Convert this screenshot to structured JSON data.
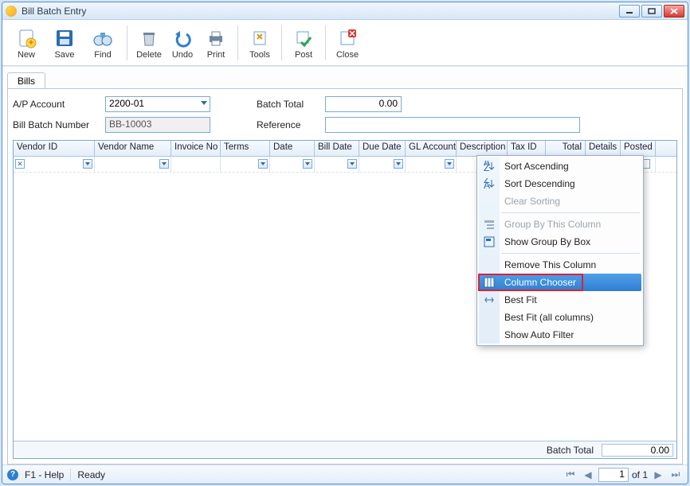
{
  "window": {
    "title": "Bill Batch Entry"
  },
  "toolbar": {
    "new": "New",
    "save": "Save",
    "find": "Find",
    "delete": "Delete",
    "undo": "Undo",
    "print": "Print",
    "tools": "Tools",
    "post": "Post",
    "close": "Close"
  },
  "tabs": {
    "bills": "Bills"
  },
  "form": {
    "ap_label": "A/P Account",
    "ap_value": "2200-01",
    "bbn_label": "Bill Batch Number",
    "bbn_value": "BB-10003",
    "bt_label": "Batch Total",
    "bt_value": "0.00",
    "ref_label": "Reference",
    "ref_value": ""
  },
  "columns": [
    "Vendor ID",
    "Vendor Name",
    "Invoice No",
    "Terms",
    "Date",
    "Bill Date",
    "Due Date",
    "GL Account",
    "Description",
    "Tax ID",
    "Total",
    "Details",
    "Posted"
  ],
  "footer": {
    "label": "Batch Total",
    "value": "0.00"
  },
  "context_menu": {
    "sort_asc": "Sort Ascending",
    "sort_desc": "Sort Descending",
    "clear_sort": "Clear Sorting",
    "group_by": "Group By This Column",
    "show_groupbox": "Show Group By Box",
    "remove_col": "Remove This Column",
    "col_chooser": "Column Chooser",
    "best_fit": "Best Fit",
    "best_fit_all": "Best Fit (all columns)",
    "show_autofilter": "Show Auto Filter"
  },
  "statusbar": {
    "help": "F1 - Help",
    "ready": "Ready",
    "page": "1",
    "of": "of  1"
  }
}
